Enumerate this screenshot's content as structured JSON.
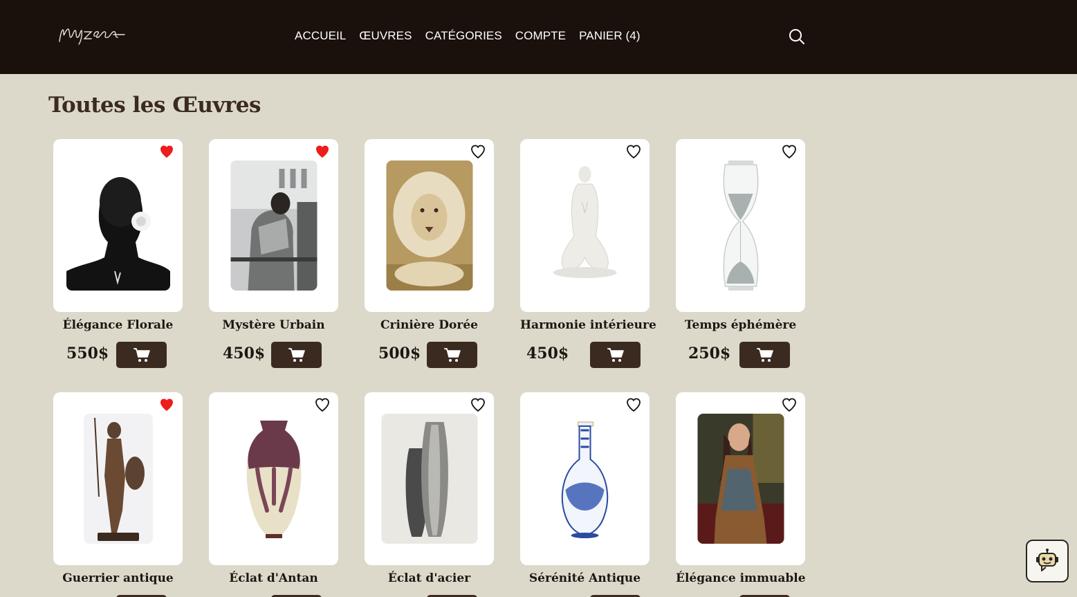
{
  "brand": {
    "logo_text": "Muzea"
  },
  "nav": {
    "items": [
      {
        "label": "ACCUEIL"
      },
      {
        "label": "ŒUVRES"
      },
      {
        "label": "CATÉGORIES"
      },
      {
        "label": "COMPTE"
      },
      {
        "label": "PANIER (4)"
      }
    ]
  },
  "search": {
    "icon": "search-icon"
  },
  "page": {
    "title": "Toutes les Œuvres"
  },
  "products": [
    {
      "name": "Élégance Florale",
      "price": "550$",
      "favorited": true,
      "art": "portrait-flower"
    },
    {
      "name": "Mystère Urbain",
      "price": "450$",
      "favorited": true,
      "art": "urban-figure"
    },
    {
      "name": "Crinière Dorée",
      "price": "500$",
      "favorited": false,
      "art": "lion"
    },
    {
      "name": "Harmonie intérieure",
      "price": "450$",
      "favorited": false,
      "art": "yoga-statue"
    },
    {
      "name": "Temps éphémère",
      "price": "250$",
      "favorited": false,
      "art": "hourglass"
    },
    {
      "name": "Guerrier antique",
      "price": "",
      "favorited": true,
      "art": "warrior-statue"
    },
    {
      "name": "Éclat d'Antan",
      "price": "",
      "favorited": false,
      "art": "art-nouveau-vase"
    },
    {
      "name": "Éclat d'acier",
      "price": "",
      "favorited": false,
      "art": "steel-vases"
    },
    {
      "name": "Sérénité Antique",
      "price": "",
      "favorited": false,
      "art": "blue-vase"
    },
    {
      "name": "Élégance immuable",
      "price": "",
      "favorited": false,
      "art": "woman-painting"
    }
  ],
  "colors": {
    "header_bg": "#1a110c",
    "page_bg": "#dcd9cb",
    "accent": "#3b2a20",
    "heart_active": "#ee1c1c"
  },
  "chatbot": {
    "icon": "robot-icon"
  }
}
